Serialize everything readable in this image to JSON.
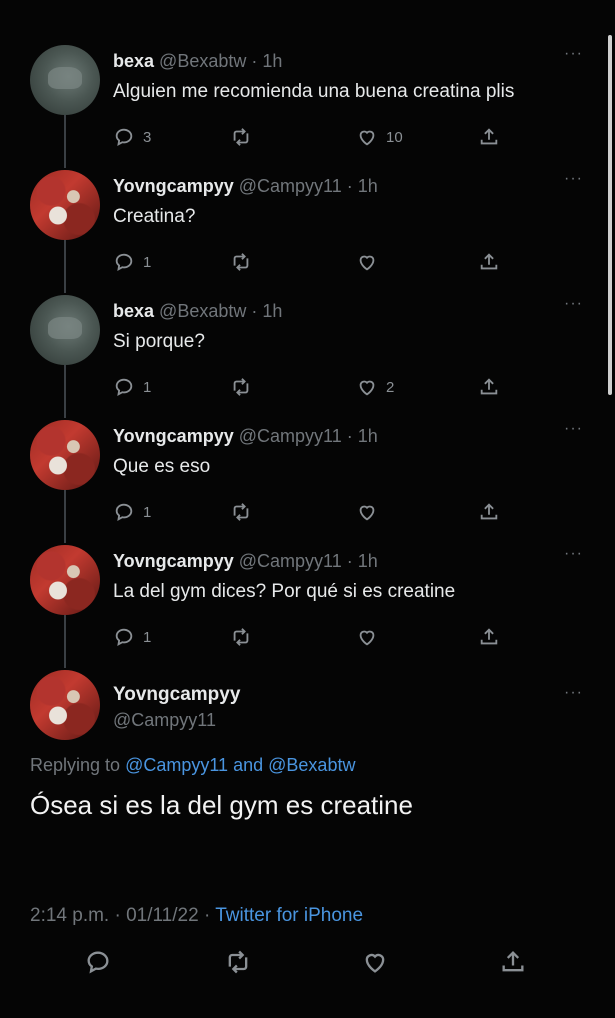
{
  "tweets": [
    {
      "name": "bexa",
      "handle": "@Bexabtw",
      "time": "· 1h",
      "text": "Alguien me recomienda una buena creatina plis",
      "replies": "3",
      "retweets": "",
      "likes": "10",
      "avatar": "bexa-avatar"
    },
    {
      "name": "Yovngcampyy",
      "handle": "@Campyy11",
      "time": "· 1h",
      "text": "Creatina?",
      "replies": "1",
      "retweets": "",
      "likes": "",
      "avatar": "campyy-avatar"
    },
    {
      "name": "bexa",
      "handle": "@Bexabtw",
      "time": "· 1h",
      "text": "Si porque?",
      "replies": "1",
      "retweets": "",
      "likes": "2",
      "avatar": "bexa-avatar"
    },
    {
      "name": "Yovngcampyy",
      "handle": "@Campyy11",
      "time": "· 1h",
      "text": "Que es eso",
      "replies": "1",
      "retweets": "",
      "likes": "",
      "avatar": "campyy-avatar"
    },
    {
      "name": "Yovngcampyy",
      "handle": "@Campyy11",
      "time": "· 1h",
      "text": "La del gym dices? Por qué si es creatine",
      "replies": "1",
      "retweets": "",
      "likes": "",
      "avatar": "campyy-avatar"
    }
  ],
  "focused": {
    "name": "Yovngcampyy",
    "handle": "@Campyy11",
    "replying_prefix": "Replying to",
    "replying_to_1": "@Campyy11",
    "replying_and": "and",
    "replying_to_2": "@Bexabtw",
    "text": "Ósea si es la del gym es creatine",
    "time": "2:14 p.m.",
    "date": "01/11/22",
    "source": "Twitter for iPhone"
  },
  "more_label": "···",
  "separator": "·",
  "colors": {
    "background": "#050505",
    "link": "#4a95e0",
    "muted": "#71767b"
  }
}
